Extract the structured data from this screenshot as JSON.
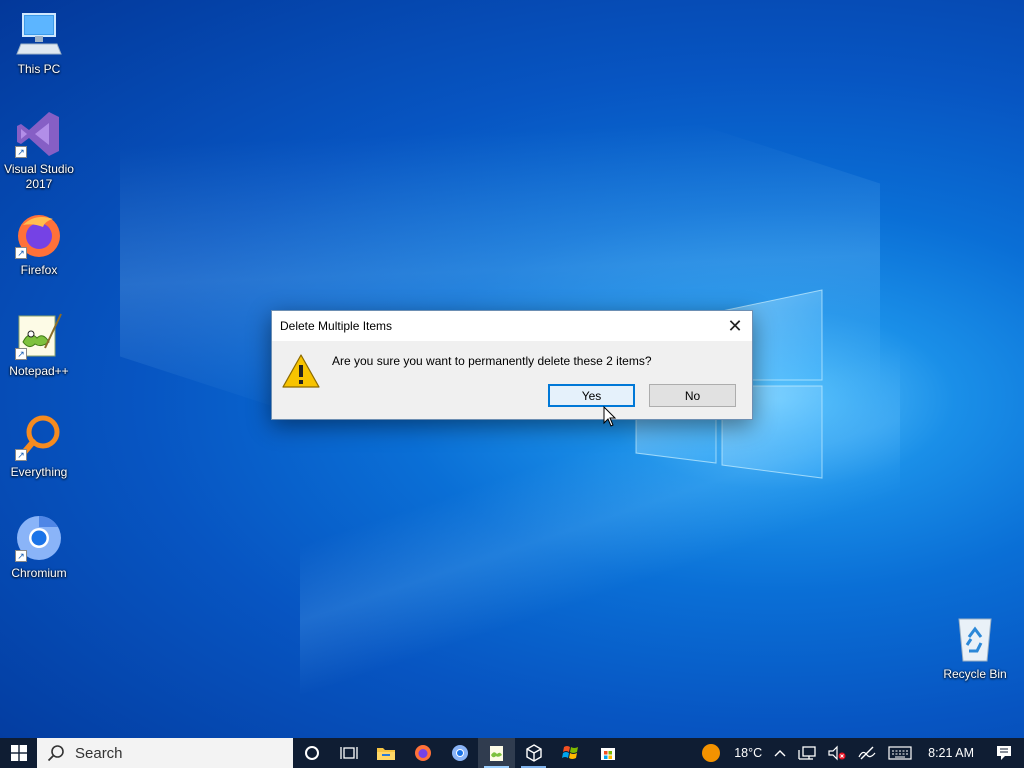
{
  "desktop": {
    "icons": [
      {
        "label": "This PC",
        "icon": "computer-icon"
      },
      {
        "label": "Visual Studio 2017",
        "icon": "visual-studio-icon",
        "shortcut": true
      },
      {
        "label": "Firefox",
        "icon": "firefox-icon",
        "shortcut": true
      },
      {
        "label": "Notepad++",
        "icon": "notepadpp-icon",
        "shortcut": true
      },
      {
        "label": "Everything",
        "icon": "everything-search-icon",
        "shortcut": true
      },
      {
        "label": "Chromium",
        "icon": "chromium-icon",
        "shortcut": true
      },
      {
        "label": "Recycle Bin",
        "icon": "recycle-bin-icon"
      }
    ]
  },
  "dialog": {
    "title": "Delete Multiple Items",
    "close_glyph": "✕",
    "icon": "warning-icon",
    "message": "Are you sure you want to permanently delete these 2 items?",
    "yes_label": "Yes",
    "no_label": "No",
    "default_button": "Yes"
  },
  "taskbar": {
    "search_placeholder": "Search",
    "apps": [
      {
        "name": "cortana",
        "icon": "cortana-circle-icon"
      },
      {
        "name": "task-view",
        "icon": "task-view-icon"
      },
      {
        "name": "file-explorer",
        "icon": "folder-icon"
      },
      {
        "name": "firefox",
        "icon": "firefox-icon"
      },
      {
        "name": "chromium",
        "icon": "chromium-icon"
      },
      {
        "name": "notepad-plus-plus",
        "icon": "notepadpp-icon",
        "active": true
      },
      {
        "name": "virtualbox",
        "icon": "cube-icon",
        "running": true
      },
      {
        "name": "visual-studio",
        "icon": "windows-flag-icon"
      },
      {
        "name": "store",
        "icon": "store-icon"
      }
    ],
    "tray": {
      "weather_temp": "18°C",
      "clock": "8:21 AM"
    }
  },
  "colors": {
    "accent": "#0078d7",
    "taskbar_bg": "#0f1d33",
    "dialog_bg": "#f0f0f0",
    "warning_yellow": "#f7c300"
  }
}
